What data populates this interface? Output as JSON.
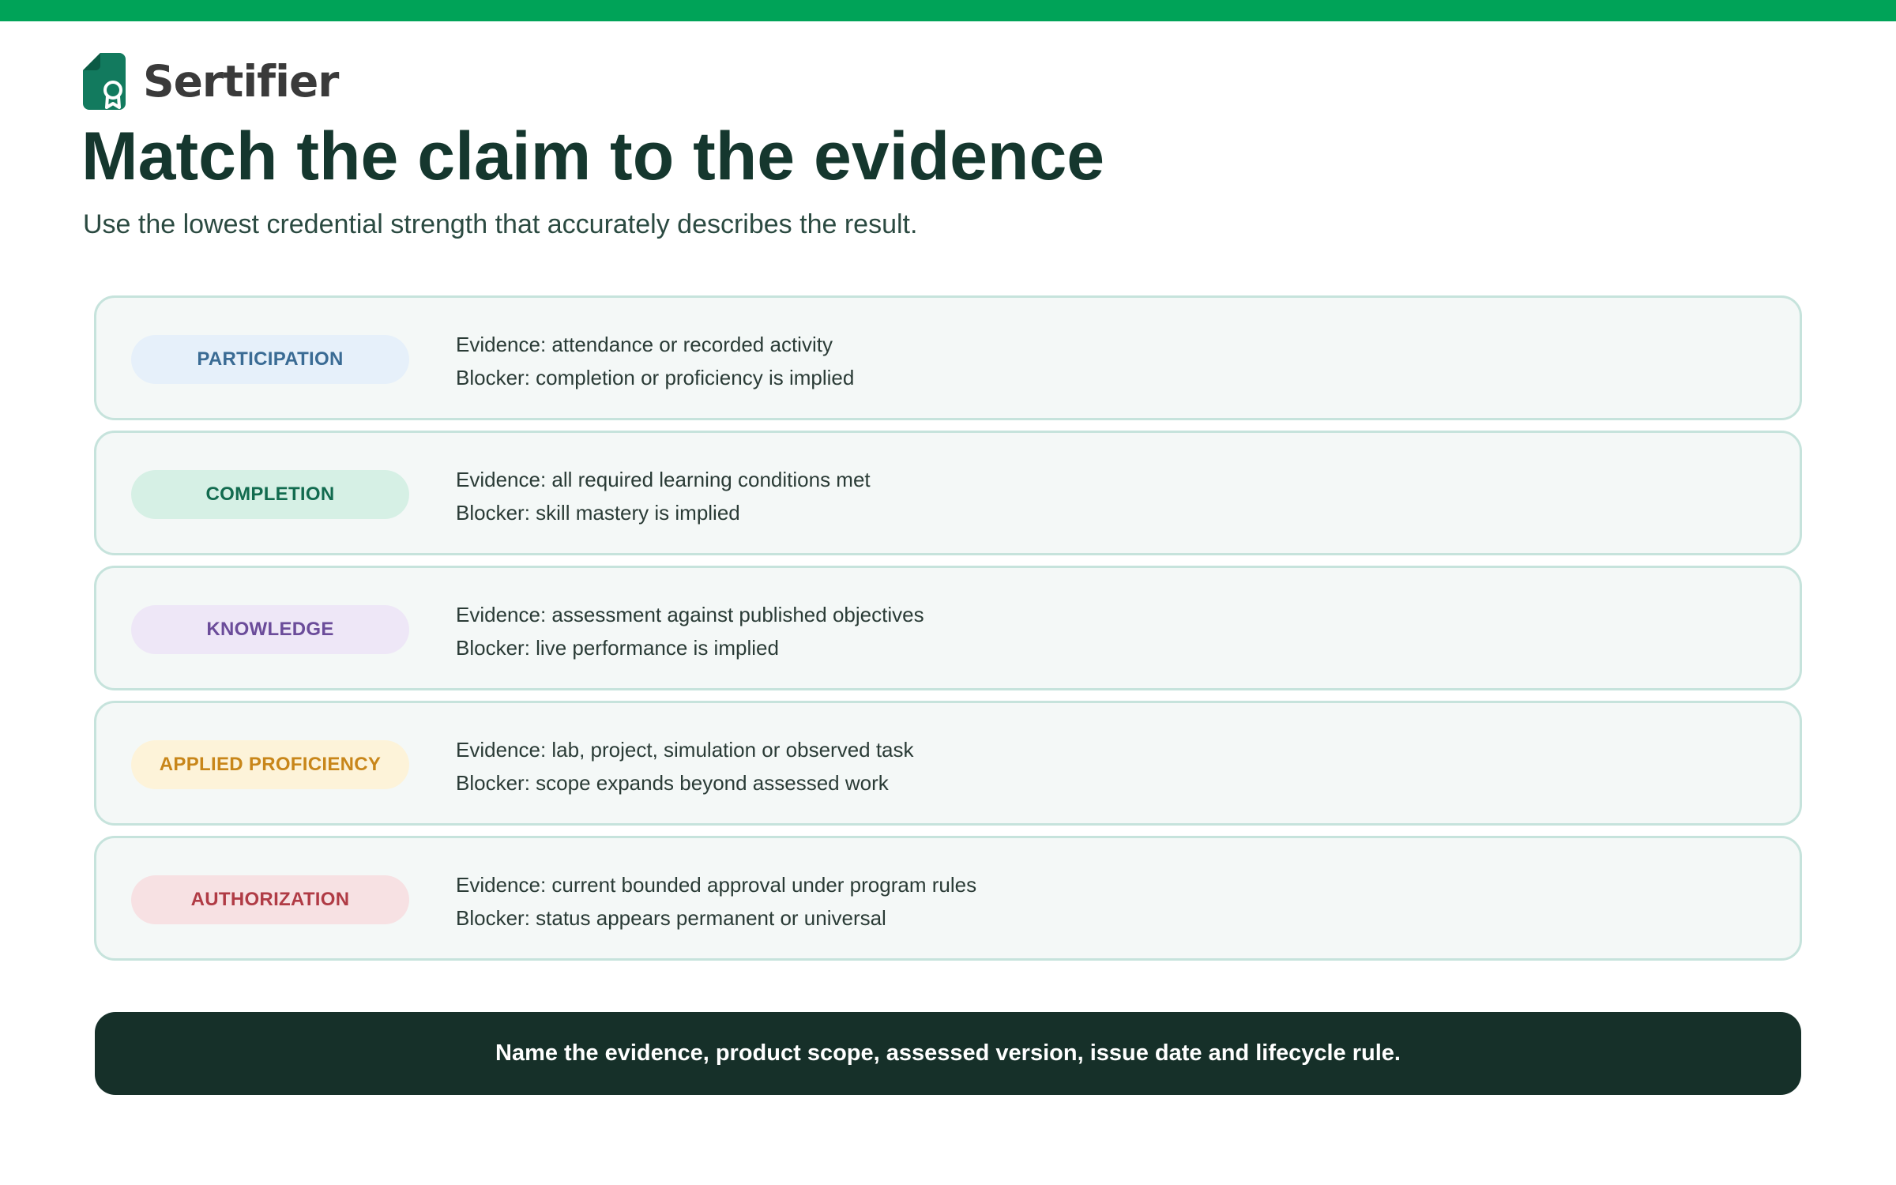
{
  "brand": {
    "name": "Sertifier",
    "logo_icon": "certificate-ribbon-icon",
    "logo_color": "#127a5e"
  },
  "page": {
    "title": "Match the claim to the evidence",
    "subtitle": "Use the lowest credential strength that accurately describes the result."
  },
  "colors": {
    "top_bar": "#00a358",
    "row_border": "#c6e3dc",
    "row_background": "#f4f8f7",
    "banner_background": "#163029"
  },
  "claims": [
    {
      "label": "PARTICIPATION",
      "evidence": "Evidence: attendance or recorded activity",
      "blocker": "Blocker: completion or proficiency is implied",
      "badge_bg": "#e6f0fa",
      "badge_fg": "#3a6b94"
    },
    {
      "label": "COMPLETION",
      "evidence": "Evidence: all required learning conditions met",
      "blocker": "Blocker: skill mastery is implied",
      "badge_bg": "#d6f0e5",
      "badge_fg": "#126b4f"
    },
    {
      "label": "KNOWLEDGE",
      "evidence": "Evidence: assessment against published objectives",
      "blocker": "Blocker: live performance is implied",
      "badge_bg": "#eee7f7",
      "badge_fg": "#6b4c9a"
    },
    {
      "label": "APPLIED PROFICIENCY",
      "evidence": "Evidence: lab, project, simulation or observed task",
      "blocker": "Blocker: scope expands beyond assessed work",
      "badge_bg": "#fdf3d9",
      "badge_fg": "#c8861a"
    },
    {
      "label": "AUTHORIZATION",
      "evidence": "Evidence: current bounded approval under program rules",
      "blocker": "Blocker: status appears permanent or universal",
      "badge_bg": "#f7e1e3",
      "badge_fg": "#b03b45"
    }
  ],
  "footer": {
    "text": "Name the evidence, product scope, assessed version, issue date and lifecycle rule."
  }
}
